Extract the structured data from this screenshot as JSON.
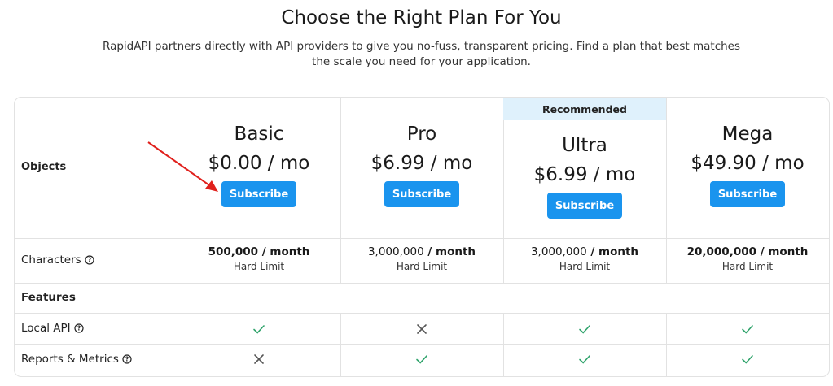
{
  "header": {
    "title": "Choose the Right Plan For You",
    "subtitle": "RapidAPI partners directly with API providers to give you no-fuss, transparent pricing. Find a plan that best matches the scale you need for your application."
  },
  "rows": {
    "objects": "Objects",
    "characters": "Characters",
    "features": "Features",
    "local_api": "Local API",
    "reports": "Reports & Metrics"
  },
  "recommended_label": "Recommended",
  "plans": [
    {
      "name": "Basic",
      "price": "$0.00 / mo",
      "cta": "Subscribe",
      "chars_amount": "500,000",
      "chars_unit": " / month",
      "chars_limit": "Hard Limit",
      "local_api": true,
      "reports": false
    },
    {
      "name": "Pro",
      "price": "$6.99 / mo",
      "cta": "Subscribe",
      "chars_amount": "3,000,000",
      "chars_unit": " / month",
      "chars_limit": "Hard Limit",
      "local_api": false,
      "reports": true
    },
    {
      "name": "Ultra",
      "price": "$6.99 / mo",
      "cta": "Subscribe",
      "chars_amount": "3,000,000",
      "chars_unit": " / month",
      "chars_limit": "Hard Limit",
      "local_api": true,
      "reports": true,
      "recommended": true
    },
    {
      "name": "Mega",
      "price": "$49.90 / mo",
      "cta": "Subscribe",
      "chars_amount": "20,000,000",
      "chars_unit": " / month",
      "chars_limit": "Hard Limit",
      "local_api": true,
      "reports": true
    }
  ],
  "icons": {
    "info": "info-circle-icon",
    "check": "check-icon",
    "cross": "cross-icon",
    "annotation": "red-arrow-annotation"
  },
  "colors": {
    "accent": "#1a94ee",
    "check": "#2fa36b",
    "cross": "#555555",
    "recommended_bg": "#dff1fc",
    "arrow": "#e0201c"
  }
}
